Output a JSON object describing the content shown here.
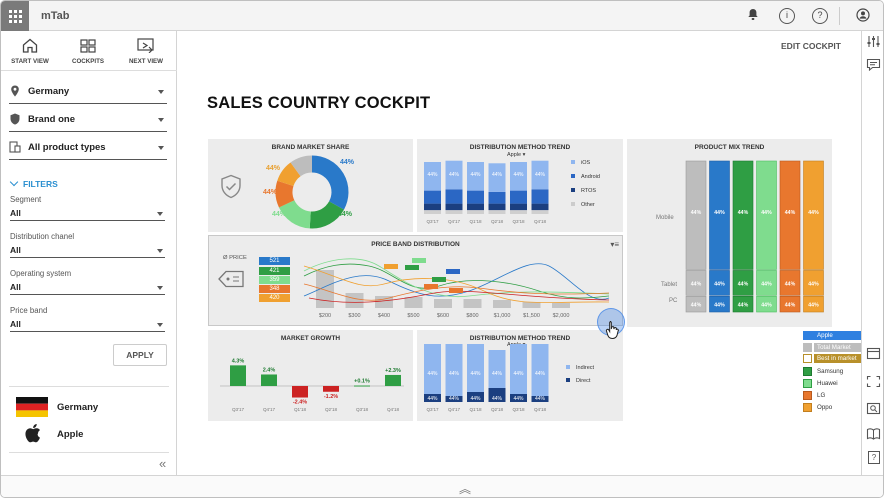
{
  "app": {
    "title": "mTab"
  },
  "nav": {
    "start_view": "START VIEW",
    "cockpits": "COCKPITS",
    "next_view": "NEXT VIEW"
  },
  "selectors": {
    "country": "Germany",
    "brand": "Brand one",
    "product_types": "All product types"
  },
  "filters": {
    "title": "FILTERS",
    "items": [
      {
        "label": "Segment",
        "value": "All"
      },
      {
        "label": "Distribution chanel",
        "value": "All"
      },
      {
        "label": "Operating system",
        "value": "All"
      },
      {
        "label": "Price band",
        "value": "All"
      }
    ],
    "apply": "APPLY"
  },
  "context": {
    "country": "Germany",
    "brand": "Apple"
  },
  "header": {
    "edit_cockpit": "EDIT COCKPIT",
    "page_title": "SALES COUNTRY COCKPIT"
  },
  "colors": {
    "blue": "#2979c9",
    "green": "#2f9e44",
    "light_green": "#7fdc8e",
    "orange": "#e8772e",
    "amber": "#f0a030",
    "red": "#cc2222",
    "gray": "#bdbdbd",
    "light_blue": "#8fb6ef",
    "mid_blue": "#2b67c4",
    "navy": "#1b3f80",
    "gold": "#b8902a"
  },
  "brand_share": {
    "title": "BRAND MARKET SHARE",
    "icon": "shield-check-icon",
    "labels": [
      "44%",
      "44%",
      "44%",
      "44%",
      "44%",
      "44%"
    ]
  },
  "dist_trend_top": {
    "title": "DISTRIBUTION METHOD TREND",
    "dropdown": "Apple",
    "bar_label": "44%",
    "categories": [
      "Q3'17",
      "Q4'17",
      "Q1'18",
      "Q2'18",
      "Q3'18",
      "Q4'18"
    ],
    "legend": [
      "iOS",
      "Android",
      "RTOS",
      "Other"
    ]
  },
  "product_mix": {
    "title": "PRODUCT MIX TREND",
    "row_labels": [
      "Mobile",
      "Tablet",
      "PC"
    ],
    "bar_label": "44%"
  },
  "price_band": {
    "title": "PRICE BAND DISTRIBUTION",
    "avg_label": "Ø PRICE",
    "icon": "price-tag-icon",
    "price_values": [
      "521",
      "421",
      "359",
      "348",
      "420"
    ],
    "x_labels": [
      "$200",
      "$300",
      "$400",
      "$500",
      "$600",
      "$800",
      "$1,000",
      "$1,500",
      "$2,000"
    ],
    "menu_icon": "menu-icon"
  },
  "market_growth": {
    "title": "MARKET GROWTH",
    "categories": [
      "Q3'17",
      "Q4'17",
      "Q1'18",
      "Q2'18",
      "Q3'18",
      "Q4'18"
    ],
    "value_labels": [
      "4.3%",
      "2.4%",
      "-2.4%",
      "-1.2%",
      "+0.1%",
      "+2.3%"
    ]
  },
  "dist_trend_bottom": {
    "title": "DISTRIBUTION METHOD TREND",
    "dropdown": "Apple",
    "bar_label": "44%",
    "categories": [
      "Q3'17",
      "Q4'17",
      "Q1'18",
      "Q2'18",
      "Q3'18",
      "Q4'18"
    ],
    "legend": [
      "Indirect",
      "Direct"
    ]
  },
  "brand_legend": {
    "items": [
      "Apple",
      "Total Market",
      "Best in market",
      "Samsung",
      "Huawei",
      "LG",
      "Oppo"
    ]
  },
  "chart_data": [
    {
      "type": "pie",
      "title": "BRAND MARKET SHARE",
      "categories": [
        "Blue",
        "Green",
        "Light green",
        "Orange",
        "Amber",
        "Gray"
      ],
      "values": [
        33,
        18,
        17,
        12,
        10,
        10
      ],
      "data_labels": [
        "44%",
        "44%",
        "44%",
        "44%",
        "44%",
        "44%"
      ]
    },
    {
      "type": "bar",
      "title": "DISTRIBUTION METHOD TREND",
      "categories": [
        "Q3'17",
        "Q4'17",
        "Q1'18",
        "Q2'18",
        "Q3'18",
        "Q4'18"
      ],
      "series": [
        {
          "name": "iOS",
          "values": [
            44,
            44,
            44,
            44,
            44,
            44
          ]
        },
        {
          "name": "Android",
          "values": [
            20,
            22,
            20,
            18,
            20,
            22
          ]
        },
        {
          "name": "RTOS",
          "values": [
            10,
            10,
            10,
            10,
            10,
            10
          ]
        },
        {
          "name": "Other",
          "values": [
            6,
            6,
            6,
            6,
            6,
            6
          ]
        }
      ]
    },
    {
      "type": "bar",
      "title": "PRODUCT MIX TREND",
      "categories": [
        "Gray",
        "Blue",
        "Green",
        "Light green",
        "Orange",
        "Amber"
      ],
      "series": [
        {
          "name": "Mobile",
          "values": [
            44,
            44,
            44,
            44,
            44,
            44
          ]
        },
        {
          "name": "Tablet",
          "values": [
            44,
            44,
            44,
            44,
            44,
            44
          ]
        },
        {
          "name": "PC",
          "values": [
            44,
            44,
            44,
            44,
            44,
            44
          ]
        }
      ]
    },
    {
      "type": "bar",
      "title": "MARKET GROWTH",
      "categories": [
        "Q3'17",
        "Q4'17",
        "Q1'18",
        "Q2'18",
        "Q3'18",
        "Q4'18"
      ],
      "values": [
        4.3,
        2.4,
        -2.4,
        -1.2,
        0.1,
        2.3
      ]
    },
    {
      "type": "bar",
      "title": "DISTRIBUTION METHOD TREND",
      "categories": [
        "Q3'17",
        "Q4'17",
        "Q1'18",
        "Q2'18",
        "Q3'18",
        "Q4'18"
      ],
      "series": [
        {
          "name": "Indirect",
          "values": [
            44,
            44,
            44,
            44,
            44,
            44
          ]
        },
        {
          "name": "Direct",
          "values": [
            44,
            44,
            44,
            44,
            44,
            44
          ]
        }
      ]
    },
    {
      "type": "bar",
      "title": "PRICE BAND DISTRIBUTION",
      "categories": [
        "$200",
        "$300",
        "$400",
        "$500",
        "$600",
        "$800",
        "$1,000",
        "$1,500",
        "$2,000"
      ],
      "values": [
        38,
        15,
        12,
        11,
        9,
        9,
        8,
        6,
        5
      ]
    }
  ]
}
